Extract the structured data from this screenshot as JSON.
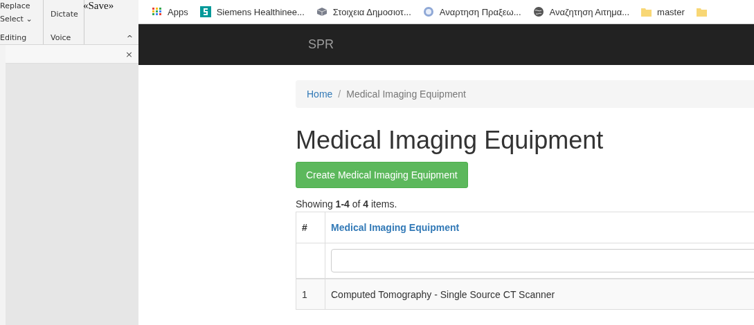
{
  "overlay_text": "«Save»",
  "ribbon": {
    "groups": [
      {
        "label": "Editing",
        "items": [
          "Replace",
          "Select ⌄"
        ]
      },
      {
        "label": "Voice",
        "items": [
          "Dictate"
        ]
      }
    ],
    "collapse": "^",
    "pane_close": "×"
  },
  "bookmarks": [
    {
      "label": "Apps",
      "kind": "apps"
    },
    {
      "label": "Siemens Healthinee...",
      "kind": "siemens"
    },
    {
      "label": "Στοιχεια Δημοσιοτ...",
      "kind": "cube"
    },
    {
      "label": "Αναρτηση Πραξεω...",
      "kind": "seal"
    },
    {
      "label": "Αναζητηση Αιτημα...",
      "kind": "globe"
    },
    {
      "label": "master",
      "kind": "folder"
    },
    {
      "kind": "folder"
    }
  ],
  "navbar": {
    "brand": "SPR"
  },
  "breadcrumb_separator": "/",
  "breadcrumb": [
    {
      "label": "Home",
      "link": true
    },
    {
      "label": "Medical Imaging Equipment",
      "link": false
    }
  ],
  "title": "Medical Imaging Equipment",
  "create_button": "Create Medical Imaging Equipment",
  "summary": "Showing **1-4** of **4** items.",
  "table": {
    "columns": [
      "#",
      "Medical Imaging Equipment"
    ],
    "rows": [
      [
        "1",
        "Computed Tomography - Single Source CT Scanner"
      ]
    ]
  }
}
